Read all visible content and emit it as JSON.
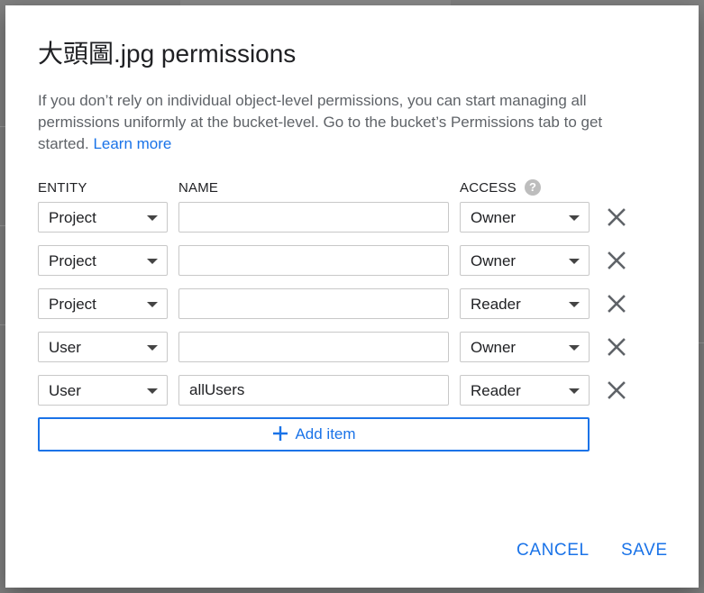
{
  "dialog": {
    "title": "大頭圖.jpg permissions",
    "description": "If you don’t rely on individual object-level permissions, you can start managing all permissions uniformly at the bucket-level. Go to the bucket’s Permissions tab to get started.",
    "learn_more": "Learn more"
  },
  "headers": {
    "entity": "ENTITY",
    "name": "NAME",
    "access": "ACCESS"
  },
  "rows": [
    {
      "entity": "Project",
      "name": "",
      "access": "Owner"
    },
    {
      "entity": "Project",
      "name": "",
      "access": "Owner"
    },
    {
      "entity": "Project",
      "name": "",
      "access": "Reader"
    },
    {
      "entity": "User",
      "name": "",
      "access": "Owner"
    },
    {
      "entity": "User",
      "name": "allUsers",
      "access": "Reader"
    }
  ],
  "add_item_label": "Add item",
  "footer": {
    "cancel": "CANCEL",
    "save": "SAVE"
  },
  "colors": {
    "accent": "#1a73e8",
    "text": "#202124",
    "secondary_text": "#5f6368",
    "border": "#c8c8c8"
  },
  "icons": {
    "help": "help-circle-icon",
    "remove": "close-icon",
    "add": "plus-icon",
    "dropdown": "caret-down-icon"
  }
}
